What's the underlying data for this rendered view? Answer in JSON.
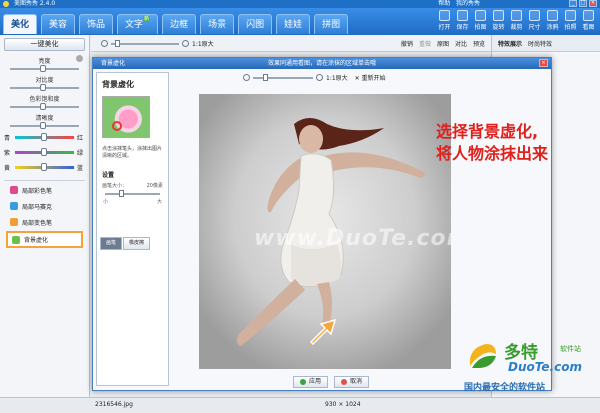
{
  "app": {
    "title": "美图秀秀 2.4.0",
    "right_links": [
      "帮助",
      "我的秀秀"
    ]
  },
  "nav": {
    "tabs": [
      {
        "label": "美化",
        "active": true
      },
      {
        "label": "美容"
      },
      {
        "label": "饰品"
      },
      {
        "label": "文字",
        "badge": "新"
      },
      {
        "label": "边框"
      },
      {
        "label": "场景"
      },
      {
        "label": "闪图"
      },
      {
        "label": "娃娃"
      },
      {
        "label": "拼图"
      }
    ],
    "tools": [
      "打开",
      "保存",
      "拍图",
      "旋转",
      "裁剪",
      "尺寸",
      "涂鸦",
      "拍照",
      "看图"
    ]
  },
  "left": {
    "one_click": "一键美化",
    "sliders": [
      "亮度",
      "对比度",
      "色彩饱和度",
      "清晰度"
    ],
    "color_rows": [
      {
        "left": "青",
        "right": "红",
        "gradient": "linear-gradient(90deg,#00c8d8,#ff4040)"
      },
      {
        "left": "紫",
        "right": "绿",
        "gradient": "linear-gradient(90deg,#b040d0,#30c040)"
      },
      {
        "left": "黄",
        "right": "蓝",
        "gradient": "linear-gradient(90deg,#f0d020,#3060e0)"
      }
    ],
    "brushes": [
      {
        "label": "局部彩色笔",
        "color": "#e04a8a"
      },
      {
        "label": "局部马赛克",
        "color": "#3a9be0"
      },
      {
        "label": "局部变色笔",
        "color": "#f0a030"
      },
      {
        "label": "背景虚化",
        "color": "#6cc04a",
        "active": true
      }
    ]
  },
  "subbar": {
    "zoom": "1:1原大",
    "actions": [
      "撤销",
      "重做",
      "原图",
      "对比",
      "预览"
    ]
  },
  "right": {
    "tabs": [
      "特效展示",
      "时尚特效"
    ]
  },
  "dialog": {
    "title": "背景虚化",
    "hint": "效果同通用看图，请在涂抹的区域单击哦",
    "panel_title": "背景虚化",
    "desc": "点击涂抹笔头，涂抹出图片清晰的区域。",
    "settings": "设置",
    "brush_size_label": "画笔大小：",
    "brush_size_value": "20像素",
    "min": "小",
    "max": "大",
    "modes": [
      "画笔",
      "橡皮擦"
    ],
    "zoom": "1:1原大",
    "reset": "重新开始",
    "annotation": [
      "选择背景虚化,",
      "将人物涂抹出来"
    ],
    "watermark": "www.DuoTe.com",
    "ok": "应用",
    "cancel": "取消"
  },
  "status": {
    "filename": "2316546.jpg",
    "dims": "930 × 1024"
  },
  "site": {
    "brand": "多特",
    "sub": "软件站",
    "url": "DuoTe.com",
    "tagline": "国内最安全的软件站"
  }
}
